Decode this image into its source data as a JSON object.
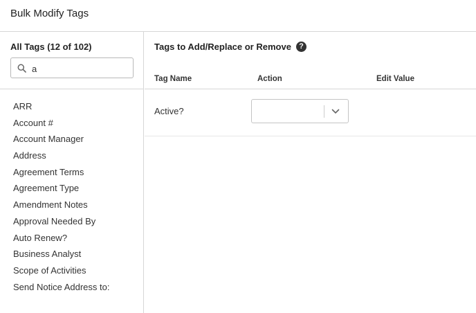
{
  "dialog": {
    "title": "Bulk Modify Tags"
  },
  "left_panel": {
    "heading": "All Tags (12 of 102)",
    "search": {
      "value": "a",
      "placeholder": ""
    },
    "tags": [
      "ARR",
      "Account #",
      "Account Manager",
      "Address",
      "Agreement Terms",
      "Agreement Type",
      "Amendment Notes",
      "Approval Needed By",
      "Auto Renew?",
      "Business Analyst",
      "Scope of Activities",
      "Send Notice Address to:"
    ]
  },
  "right_panel": {
    "heading": "Tags to Add/Replace or Remove",
    "help_icon": "question-circle-icon",
    "columns": {
      "tag_name": "Tag Name",
      "action": "Action",
      "edit_value": "Edit Value"
    },
    "rows": [
      {
        "tag_name": "Active?",
        "action_value": ""
      }
    ]
  },
  "icons": {
    "search": "search-icon",
    "dropdown": "chevron-down-icon"
  }
}
